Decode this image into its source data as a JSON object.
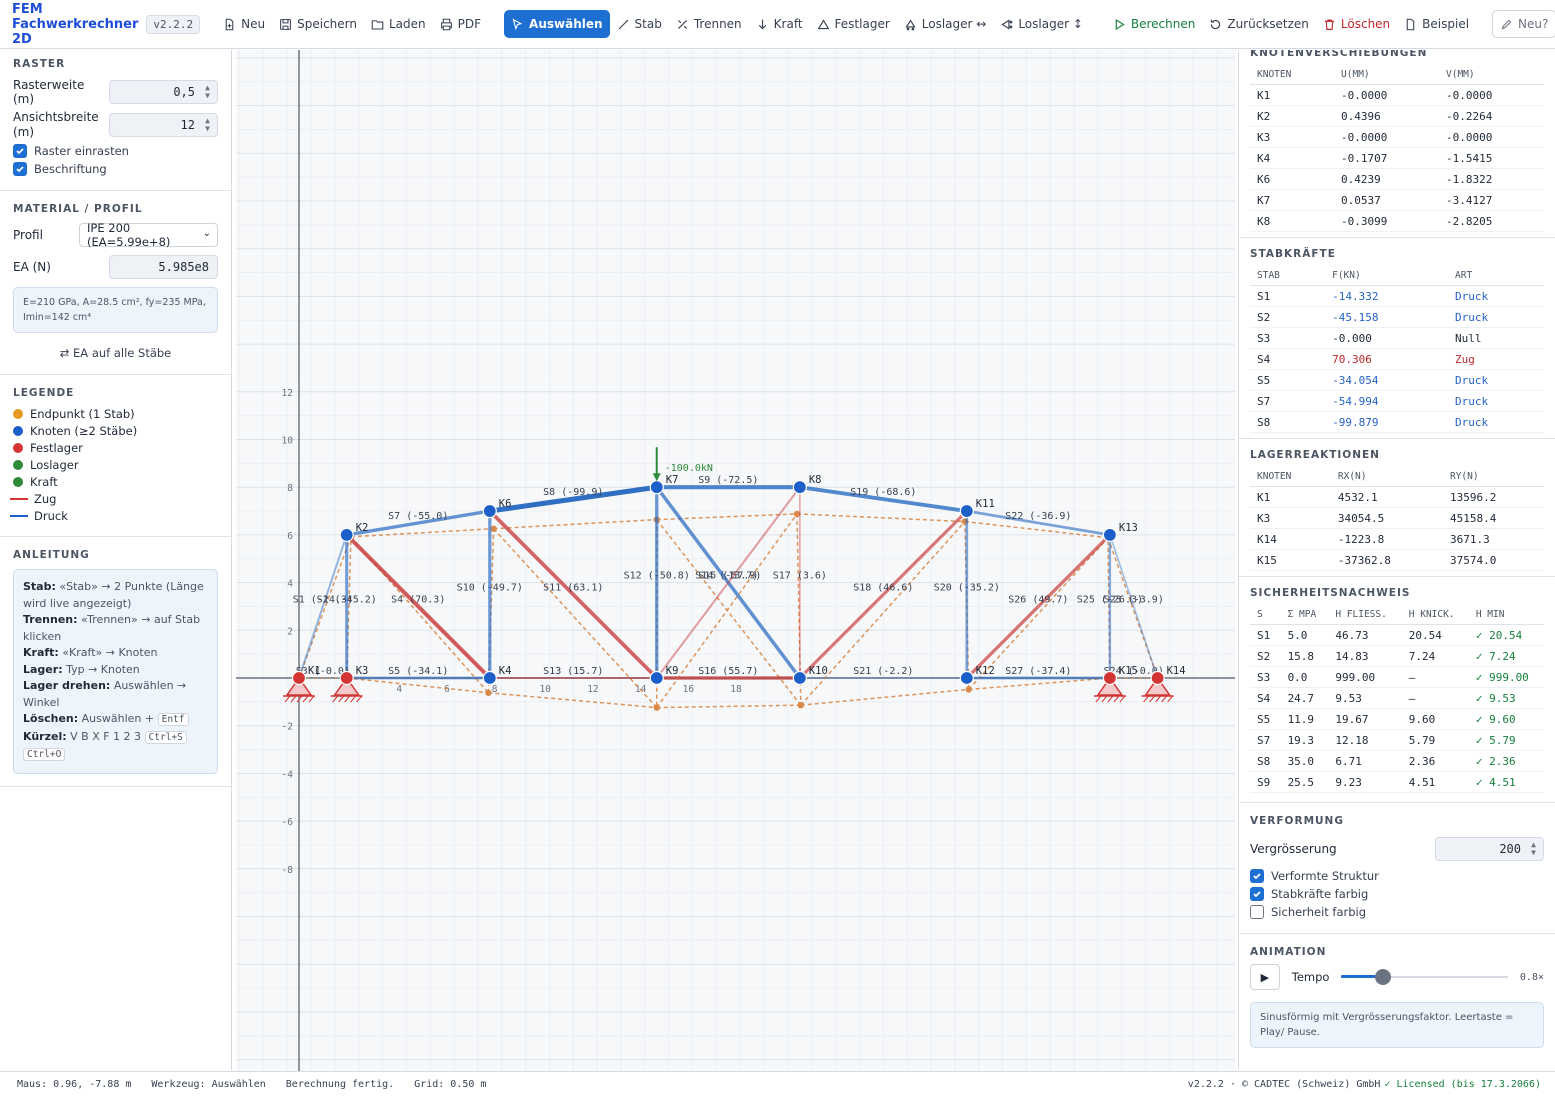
{
  "app": {
    "title": "FEM Fachwerkrechner 2D",
    "version": "v2.2.2"
  },
  "toolbar": {
    "neu": "Neu",
    "speichern": "Speichern",
    "laden": "Laden",
    "pdf": "PDF",
    "auswaehlen": "Auswählen",
    "stab": "Stab",
    "trennen": "Trennen",
    "kraft": "Kraft",
    "festlager": "Festlager",
    "loslager_h": "Loslager ↔",
    "loslager_v": "Loslager ↕",
    "berechnen": "Berechnen",
    "zuruecksetzen": "Zurücksetzen",
    "loeschen": "Löschen",
    "beispiel": "Beispiel",
    "neu_q": "Neu?"
  },
  "raster": {
    "title": "RASTER",
    "rasterweite_label": "Rasterweite (m)",
    "rasterweite": "0,5",
    "ansicht_label": "Ansichtsbreite (m)",
    "ansicht": "12",
    "einrasten": "Raster einrasten",
    "beschriftung": "Beschriftung"
  },
  "material": {
    "title": "MATERIAL / PROFIL",
    "profil_label": "Profil",
    "profil": "IPE 200 (EA=5.99e+8)",
    "ea_label": "EA (N)",
    "ea": "5.985e8",
    "info": "E=210 GPa, A=28.5 cm², fy=235 MPa, Imin=142 cm⁴",
    "ea_all": "EA auf alle Stäbe"
  },
  "legend": {
    "title": "LEGENDE",
    "items": [
      {
        "label": "Endpunkt (1 Stab)",
        "color": "#e69a22",
        "kind": "dot"
      },
      {
        "label": "Knoten (≥2 Stäbe)",
        "color": "#1d5fc8",
        "kind": "dot"
      },
      {
        "label": "Festlager",
        "color": "#d33434",
        "kind": "dot"
      },
      {
        "label": "Loslager",
        "color": "#2f8a3a",
        "kind": "dot"
      },
      {
        "label": "Kraft",
        "color": "#2f8a3a",
        "kind": "dot"
      },
      {
        "label": "Zug",
        "color": "#d33434",
        "kind": "line"
      },
      {
        "label": "Druck",
        "color": "#1d5fc8",
        "kind": "line"
      }
    ]
  },
  "guide": {
    "title": "ANLEITUNG",
    "stab_b": "Stab:",
    "stab_t": "«Stab» → 2 Punkte (Länge wird live angezeigt)",
    "trennen_b": "Trennen:",
    "trennen_t": "«Trennen» → auf Stab klicken",
    "kraft_b": "Kraft:",
    "kraft_t": "«Kraft» → Knoten",
    "lager_b": "Lager:",
    "lager_t": "Typ → Knoten",
    "drehen_b": "Lager drehen:",
    "drehen_t": "Auswählen → Winkel",
    "loeschen_b": "Löschen:",
    "loeschen_t": "Auswählen +",
    "loeschen_k": "Entf",
    "kuerzel_b": "Kürzel:",
    "kuerzel_t": "V B X F 1 2 3",
    "kuerzel_k1": "Ctrl+S",
    "kuerzel_k2": "Ctrl+O"
  },
  "verschiebungen": {
    "title": "KNOTENVERSCHIEBUNGEN",
    "headers": [
      "KNOTEN",
      "U(MM)",
      "V(MM)"
    ],
    "rows": [
      [
        "K1",
        "-0.0000",
        "-0.0000"
      ],
      [
        "K2",
        "0.4396",
        "-0.2264"
      ],
      [
        "K3",
        "-0.0000",
        "-0.0000"
      ],
      [
        "K4",
        "-0.1707",
        "-1.5415"
      ],
      [
        "K6",
        "0.4239",
        "-1.8322"
      ],
      [
        "K7",
        "0.0537",
        "-3.4127"
      ],
      [
        "K8",
        "-0.3099",
        "-2.8205"
      ]
    ]
  },
  "stabkraefte": {
    "title": "STABKRÄFTE",
    "headers": [
      "STAB",
      "F(KN)",
      "ART"
    ],
    "rows": [
      [
        "S1",
        "-14.332",
        "Druck"
      ],
      [
        "S2",
        "-45.158",
        "Druck"
      ],
      [
        "S3",
        "-0.000",
        "Null"
      ],
      [
        "S4",
        "70.306",
        "Zug"
      ],
      [
        "S5",
        "-34.054",
        "Druck"
      ],
      [
        "S7",
        "-54.994",
        "Druck"
      ],
      [
        "S8",
        "-99.879",
        "Druck"
      ]
    ]
  },
  "lager": {
    "title": "LAGERREAKTIONEN",
    "headers": [
      "KNOTEN",
      "RX(N)",
      "RY(N)"
    ],
    "rows": [
      [
        "K1",
        "4532.1",
        "13596.2"
      ],
      [
        "K3",
        "34054.5",
        "45158.4"
      ],
      [
        "K14",
        "-1223.8",
        "3671.3"
      ],
      [
        "K15",
        "-37362.8",
        "37574.0"
      ]
    ]
  },
  "sicherheit": {
    "title": "SICHERHEITSNACHWEIS",
    "headers": [
      "S",
      "Σ MPA",
      "Η FLIESS.",
      "Η KNICK.",
      "Η MIN"
    ],
    "rows": [
      [
        "S1",
        "5.0",
        "46.73",
        "20.54",
        "✓ 20.54"
      ],
      [
        "S2",
        "15.8",
        "14.83",
        "7.24",
        "✓ 7.24"
      ],
      [
        "S3",
        "0.0",
        "999.00",
        "–",
        "✓ 999.00"
      ],
      [
        "S4",
        "24.7",
        "9.53",
        "–",
        "✓ 9.53"
      ],
      [
        "S5",
        "11.9",
        "19.67",
        "9.60",
        "✓ 9.60"
      ],
      [
        "S7",
        "19.3",
        "12.18",
        "5.79",
        "✓ 5.79"
      ],
      [
        "S8",
        "35.0",
        "6.71",
        "2.36",
        "✓ 2.36"
      ],
      [
        "S9",
        "25.5",
        "9.23",
        "4.51",
        "✓ 4.51"
      ]
    ]
  },
  "verformung": {
    "title": "VERFORMUNG",
    "vergr_label": "Vergrösserung",
    "vergr": "200",
    "verformte": "Verformte Struktur",
    "farbig": "Stabkräfte farbig",
    "sicherheit": "Sicherheit farbig"
  },
  "animation": {
    "title": "ANIMATION",
    "tempo_label": "Tempo",
    "tempo": "0.8×",
    "tempo_frac": 0.2,
    "info": "Sinusförmig mit Vergrösserungsfaktor. Leertaste = Play/ Pause."
  },
  "status": {
    "maus": "Maus: 0.96, -7.88 m",
    "werkzeug": "Werkzeug: Auswählen",
    "berechnung": "Berechnung fertig.",
    "grid": "Grid: 0.50 m",
    "right": "v2.2.2 · © CADTEC (Schweiz) GmbH",
    "license": "✓ Licensed (bis 17.3.2066)"
  },
  "colors": {
    "druck": "#2563c7",
    "zug": "#c0262c",
    "accent": "#1d6fd1",
    "ok": "#16803c"
  },
  "diagram": {
    "xticks": [
      "2",
      "4",
      "6",
      "8",
      "10",
      "12",
      "14",
      "16",
      "18"
    ],
    "yticks": [
      "12",
      "10",
      "8",
      "6",
      "4",
      "2",
      "-2",
      "-4",
      "-6",
      "-8"
    ],
    "load_label": "-100.0kN",
    "nodes": [
      {
        "id": "K1",
        "x": 0,
        "y": 0,
        "support": "fest"
      },
      {
        "id": "K3",
        "x": 1,
        "y": 0,
        "support": "fest"
      },
      {
        "id": "K2",
        "x": 1,
        "y": 3
      },
      {
        "id": "K4",
        "x": 4,
        "y": 0
      },
      {
        "id": "K6",
        "x": 4,
        "y": 3.5
      },
      {
        "id": "K7",
        "x": 7.5,
        "y": 4
      },
      {
        "id": "K9",
        "x": 7.5,
        "y": 0
      },
      {
        "id": "K8",
        "x": 10.5,
        "y": 4
      },
      {
        "id": "K10",
        "x": 10.5,
        "y": 0
      },
      {
        "id": "K11",
        "x": 14,
        "y": 3.5
      },
      {
        "id": "K12",
        "x": 14,
        "y": 0
      },
      {
        "id": "K13",
        "x": 17,
        "y": 3
      },
      {
        "id": "K15",
        "x": 17,
        "y": 0,
        "support": "fest"
      },
      {
        "id": "K14",
        "x": 18,
        "y": 0,
        "support": "fest"
      }
    ],
    "members": [
      {
        "id": "S1",
        "a": "K1",
        "b": "K2",
        "f": -14.332
      },
      {
        "id": "S2",
        "a": "K3",
        "b": "K2",
        "f": -45.158
      },
      {
        "id": "S3",
        "a": "K1",
        "b": "K3",
        "f": -0.0
      },
      {
        "id": "S4",
        "a": "K2",
        "b": "K4",
        "f": 70.306
      },
      {
        "id": "S5",
        "a": "K3",
        "b": "K4",
        "f": -34.054
      },
      {
        "id": "S7",
        "a": "K2",
        "b": "K6",
        "f": -54.994
      },
      {
        "id": "S8",
        "a": "K6",
        "b": "K7",
        "f": -99.879
      },
      {
        "id": "S9",
        "a": "K7",
        "b": "K8",
        "f": -72.5
      },
      {
        "id": "S10",
        "a": "K4",
        "b": "K6",
        "f": -49.7
      },
      {
        "id": "S11",
        "a": "K6",
        "b": "K9",
        "f": 63.1
      },
      {
        "id": "S12",
        "a": "K7",
        "b": "K9",
        "f": -50.8
      },
      {
        "id": "S13",
        "a": "K4",
        "b": "K9",
        "f": 15.7
      },
      {
        "id": "S14",
        "a": "K7",
        "b": "K10",
        "f": -57.9
      },
      {
        "id": "S15",
        "a": "K9",
        "b": "K8",
        "f": 13.7
      },
      {
        "id": "S16",
        "a": "K9",
        "b": "K10",
        "f": 55.7
      },
      {
        "id": "S17",
        "a": "K8",
        "b": "K10",
        "f": 3.6
      },
      {
        "id": "S18",
        "a": "K10",
        "b": "K11",
        "f": 46.6
      },
      {
        "id": "S19",
        "a": "K8",
        "b": "K11",
        "f": -68.6
      },
      {
        "id": "S20",
        "a": "K11",
        "b": "K12",
        "f": -35.2
      },
      {
        "id": "S21",
        "a": "K10",
        "b": "K12",
        "f": -2.2
      },
      {
        "id": "S22",
        "a": "K11",
        "b": "K13",
        "f": -36.9
      },
      {
        "id": "S23",
        "a": "K13",
        "b": "K14",
        "f": -3.9
      },
      {
        "id": "S24",
        "a": "K15",
        "b": "K14",
        "f": -0.0
      },
      {
        "id": "S25",
        "a": "K15",
        "b": "K13",
        "f": -26.3
      },
      {
        "id": "S26",
        "a": "K12",
        "b": "K13",
        "f": 49.7
      },
      {
        "id": "S27",
        "a": "K12",
        "b": "K15",
        "f": -37.4
      }
    ],
    "deformed": [
      {
        "id": "K1",
        "x": 0,
        "y": 0
      },
      {
        "id": "K3",
        "x": 1,
        "y": 0
      },
      {
        "id": "K2",
        "x": 1.09,
        "y": 2.96
      },
      {
        "id": "K4",
        "x": 3.97,
        "y": -0.31
      },
      {
        "id": "K6",
        "x": 4.08,
        "y": 3.13
      },
      {
        "id": "K7",
        "x": 7.5,
        "y": 3.32
      },
      {
        "id": "K9",
        "x": 7.5,
        "y": -0.62
      },
      {
        "id": "K8",
        "x": 10.44,
        "y": 3.44
      },
      {
        "id": "K10",
        "x": 10.52,
        "y": -0.57
      },
      {
        "id": "K11",
        "x": 13.96,
        "y": 3.28
      },
      {
        "id": "K12",
        "x": 14.04,
        "y": -0.24
      },
      {
        "id": "K13",
        "x": 16.96,
        "y": 2.94
      },
      {
        "id": "K15",
        "x": 17,
        "y": 0
      },
      {
        "id": "K14",
        "x": 18,
        "y": 0
      }
    ]
  }
}
